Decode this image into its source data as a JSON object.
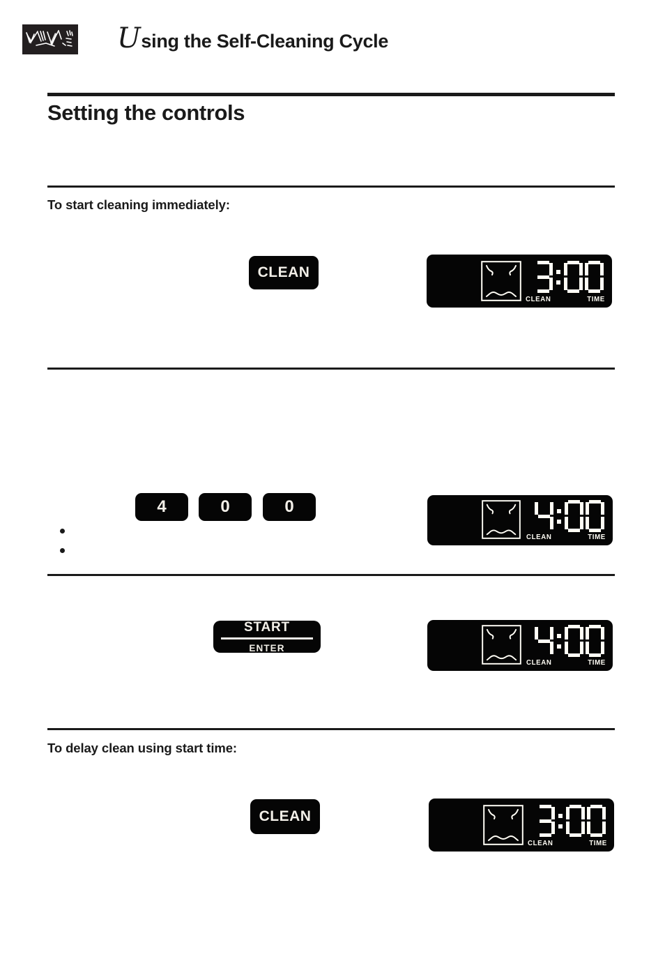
{
  "header": {
    "brand_mark_icon": "brush-stroke-logo",
    "drop_cap": "U",
    "title_rest": "sing the Self-Cleaning Cycle"
  },
  "section": {
    "title": "Setting the controls"
  },
  "steps": [
    {
      "heading": "To start cleaning immediately:",
      "button": {
        "label": "CLEAN",
        "type": "clean-key"
      },
      "display": {
        "time": "3:00",
        "digits": [
          "3",
          ":",
          "0",
          "0"
        ],
        "clean_label": "CLEAN",
        "time_label": "TIME",
        "oven_icon": "oven-cavity-icon"
      }
    },
    {
      "heading": "",
      "keys": [
        {
          "label": "4"
        },
        {
          "label": "0"
        },
        {
          "label": "0"
        }
      ],
      "bullets": [
        {
          "text": ""
        },
        {
          "text": ""
        }
      ],
      "display": {
        "time": "4:00",
        "digits": [
          "4",
          ":",
          "0",
          "0"
        ],
        "clean_label": "CLEAN",
        "time_label": "TIME",
        "oven_icon": "oven-cavity-icon"
      }
    },
    {
      "heading": "",
      "button": {
        "label_top": "START",
        "label_bottom": "ENTER",
        "type": "start-enter-key"
      },
      "display": {
        "time": "4:00",
        "digits": [
          "4",
          ":",
          "0",
          "0"
        ],
        "clean_label": "CLEAN",
        "time_label": "TIME",
        "oven_icon": "oven-cavity-icon"
      }
    },
    {
      "heading": "To delay clean using start time:",
      "button": {
        "label": "CLEAN",
        "type": "clean-key"
      },
      "display": {
        "time": "3:00",
        "digits": [
          "3",
          ":",
          "0",
          "0"
        ],
        "clean_label": "CLEAN",
        "time_label": "TIME",
        "oven_icon": "oven-cavity-icon"
      }
    }
  ],
  "colors": {
    "ink": "#1a1a1a",
    "key_black": "#050505",
    "led_white": "#fffdf5",
    "page": "#ffffff"
  }
}
